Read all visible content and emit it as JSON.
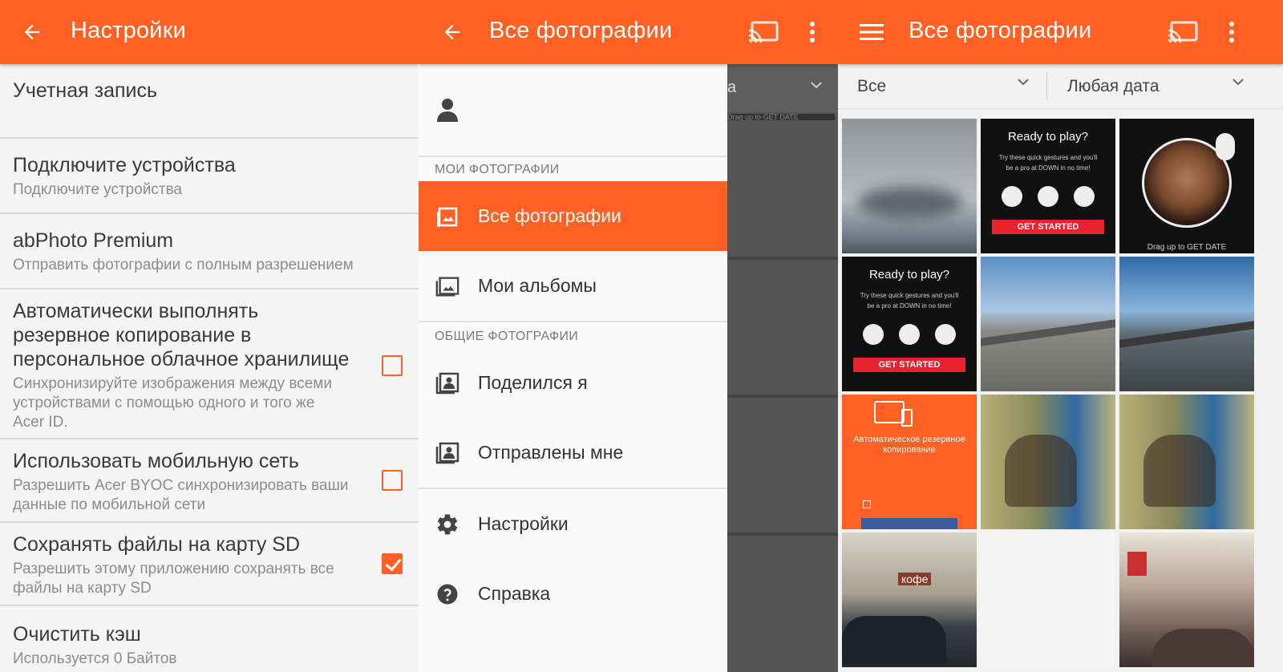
{
  "colors": {
    "accent": "#ff6125",
    "text_primary": "#3a3a3a",
    "text_secondary": "#8c8c8c"
  },
  "settings_screen": {
    "title": "Настройки",
    "items": [
      {
        "title": "Учетная запись",
        "subtitle": ""
      },
      {
        "title": "Подключите устройства",
        "subtitle": "Подключите устройства"
      },
      {
        "title": "abPhoto Premium",
        "subtitle": "Отправить фотографии с полным разрешением"
      },
      {
        "title_lines": [
          "Автоматически выполнять",
          "резервное копирование в",
          "персональное облачное хранилище"
        ],
        "subtitle_lines": [
          "Синхронизируйте изображения между всеми",
          "устройствами с помощью одного и того же",
          "Acer ID."
        ],
        "checked": false
      },
      {
        "title": "Использовать мобильную сеть",
        "subtitle_lines": [
          "Разрешить Acer BYOC синхронизировать ваши",
          "данные по мобильной сети"
        ],
        "checked": false
      },
      {
        "title": "Сохранять файлы на карту SD",
        "subtitle_lines": [
          "Разрешить этому приложению сохранять все",
          "файлы на карту SD"
        ],
        "checked": true
      },
      {
        "title": "Очистить кэш",
        "subtitle": "Используется 0 Байтов"
      }
    ]
  },
  "drawer_screen": {
    "title": "Все фотографии",
    "background_filter": "а",
    "background_hint": "Drag up to GET DATE",
    "section_my": "МОИ ФОТОГРАФИИ",
    "section_shared": "ОБЩИЕ ФОТОГРАФИИ",
    "items": [
      {
        "label": "Все фотографии",
        "icon": "photo-icon",
        "active": true
      },
      {
        "label": "Мои альбомы",
        "icon": "album-icon",
        "active": false
      },
      {
        "label": "Поделился я",
        "icon": "shared-by-me-icon",
        "active": false
      },
      {
        "label": "Отправлены мне",
        "icon": "shared-with-me-icon",
        "active": false
      },
      {
        "label": "Настройки",
        "icon": "gear-icon",
        "active": false
      },
      {
        "label": "Справка",
        "icon": "help-icon",
        "active": false
      }
    ]
  },
  "gallery_screen": {
    "title": "Все фотографии",
    "filter_type": "Все",
    "filter_date": "Любая дата",
    "tiles": {
      "ready_title": "Ready to play?",
      "ready_text_1": "Try these quick gestures and you'll",
      "ready_text_2": "be a pro at DOWN in no time!",
      "get_started": "GET STARTED",
      "drag_hint": "Drag up to GET DATE",
      "backup_title_1": "Автоматическое резервное",
      "backup_title_2": "копирование",
      "shop_sign": "кофе"
    }
  }
}
